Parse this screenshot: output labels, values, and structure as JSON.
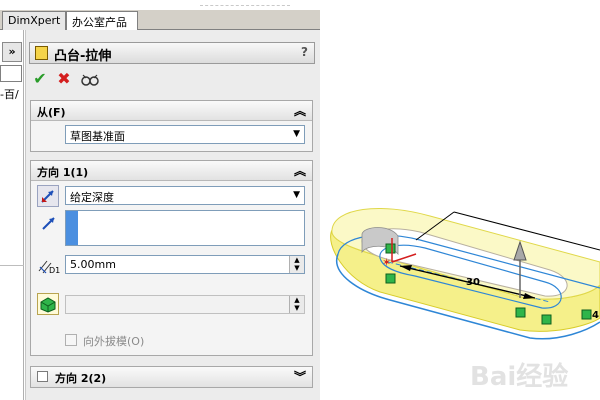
{
  "tabs": [
    {
      "label": "DimXpert",
      "active": false
    },
    {
      "label": "办公室产品",
      "active": true
    }
  ],
  "left_strip": {
    "expand_label": "»",
    "fragment_text": "-百/"
  },
  "property_manager": {
    "title": "凸台-拉伸",
    "help_label": "?",
    "actions": {
      "ok_icon": "check-icon",
      "cancel_icon": "x-icon",
      "preview_icon": "eyeglasses-icon"
    },
    "from_group": {
      "title": "从(F)",
      "start_condition": "草图基准面"
    },
    "direction1_group": {
      "title": "方向 1(1)",
      "end_condition": "给定深度",
      "direction_value": "",
      "depth_label": "D1",
      "depth": "5.00mm",
      "draft_label": "向外拔模(O)",
      "draft_checked": false
    },
    "direction2_group": {
      "title": "方向 2(2)",
      "checked": false
    }
  },
  "graphics_area": {
    "dimension_label": "30",
    "edge_label_right": "4",
    "watermark": "Bai经验",
    "preview_color": "#f5f08a",
    "sketch_color": "#2e86d6"
  }
}
